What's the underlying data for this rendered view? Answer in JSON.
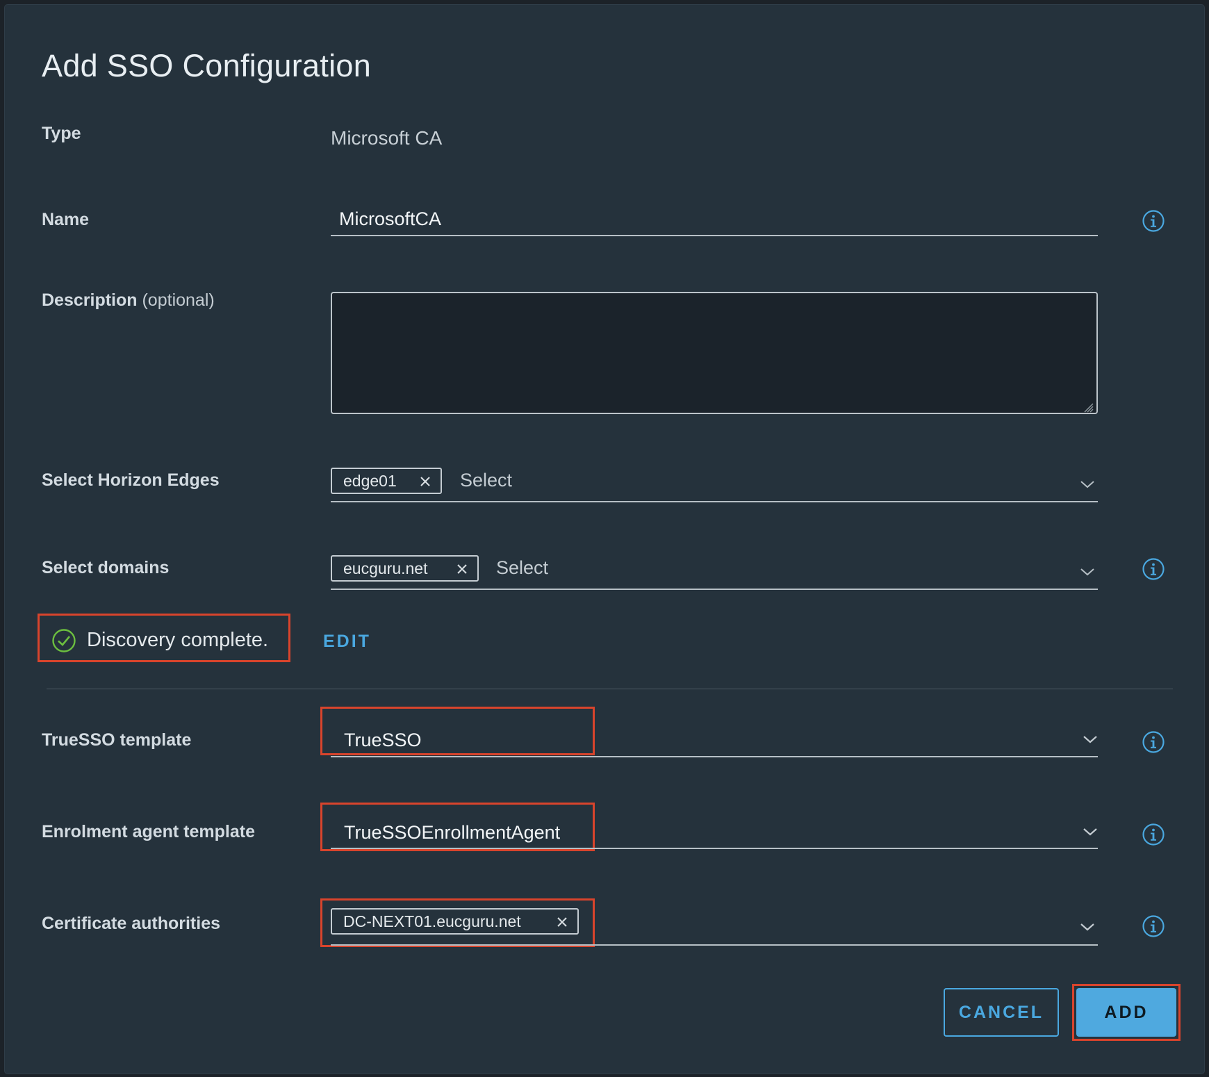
{
  "dialog": {
    "title": "Add SSO Configuration"
  },
  "fields": {
    "type": {
      "label": "Type",
      "value": "Microsoft CA"
    },
    "name": {
      "label": "Name",
      "value": "MicrosoftCA"
    },
    "description": {
      "label": "Description",
      "optional": "(optional)",
      "value": ""
    },
    "edges": {
      "label": "Select Horizon Edges",
      "chip": "edge01",
      "placeholder": "Select"
    },
    "domains": {
      "label": "Select domains",
      "chip": "eucguru.net",
      "placeholder": "Select"
    },
    "truesso_template": {
      "label": "TrueSSO template",
      "value": "TrueSSO"
    },
    "enrolment_template": {
      "label": "Enrolment agent template",
      "value": "TrueSSOEnrollmentAgent"
    },
    "cert_authorities": {
      "label": "Certificate authorities",
      "chip": "DC-NEXT01.eucguru.net"
    }
  },
  "discovery": {
    "status": "Discovery complete.",
    "edit_label": "EDIT"
  },
  "buttons": {
    "cancel": "CANCEL",
    "add": "ADD"
  },
  "colors": {
    "accent": "#4aa8e0",
    "success": "#6cbf3f",
    "highlight": "#d9442c",
    "background": "#25323c"
  },
  "icons": {
    "info": "info-circle-icon",
    "check": "check-circle-icon",
    "close": "close-icon",
    "chevron": "chevron-down-icon"
  }
}
